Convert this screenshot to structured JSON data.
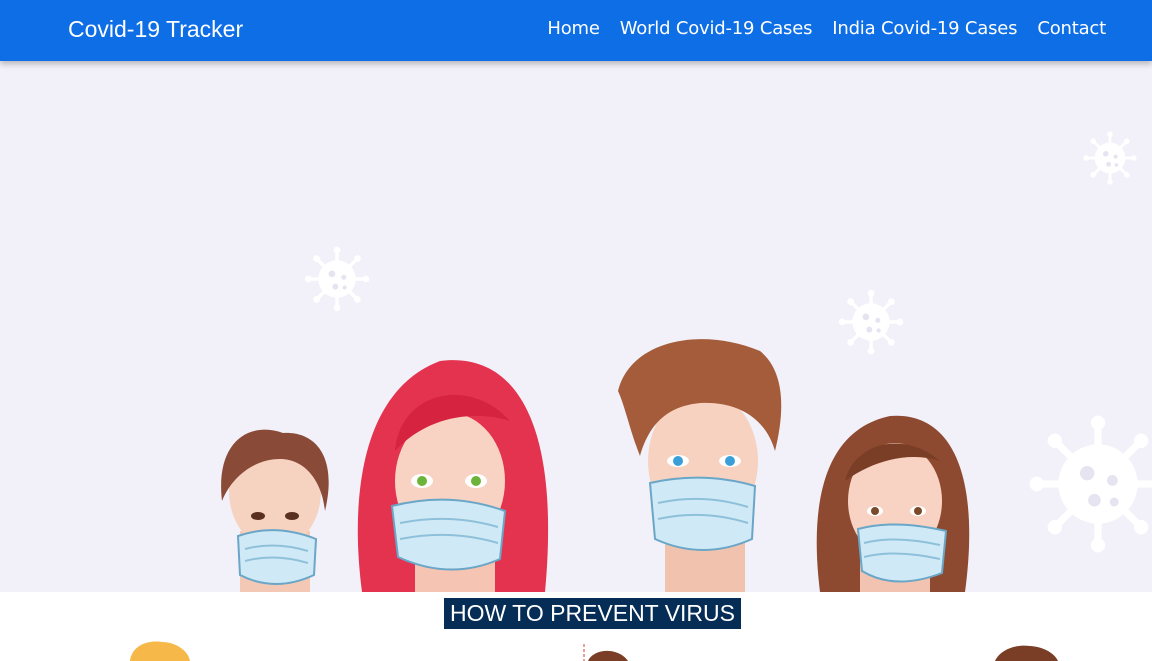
{
  "brand": "Covid-19 Tracker",
  "nav": [
    {
      "label": "Home"
    },
    {
      "label": "World Covid-19 Cases"
    },
    {
      "label": "India Covid-19 Cases"
    },
    {
      "label": "Contact"
    }
  ],
  "hero": {
    "image": "masked-people-illustration",
    "virus_icon": "coronavirus-icon"
  },
  "section": {
    "title": "HOW TO PREVENT VIRUS"
  },
  "colors": {
    "navbar": "#0d6ee6",
    "hero_background": "#f2f1f9",
    "title_background": "#062d55"
  }
}
